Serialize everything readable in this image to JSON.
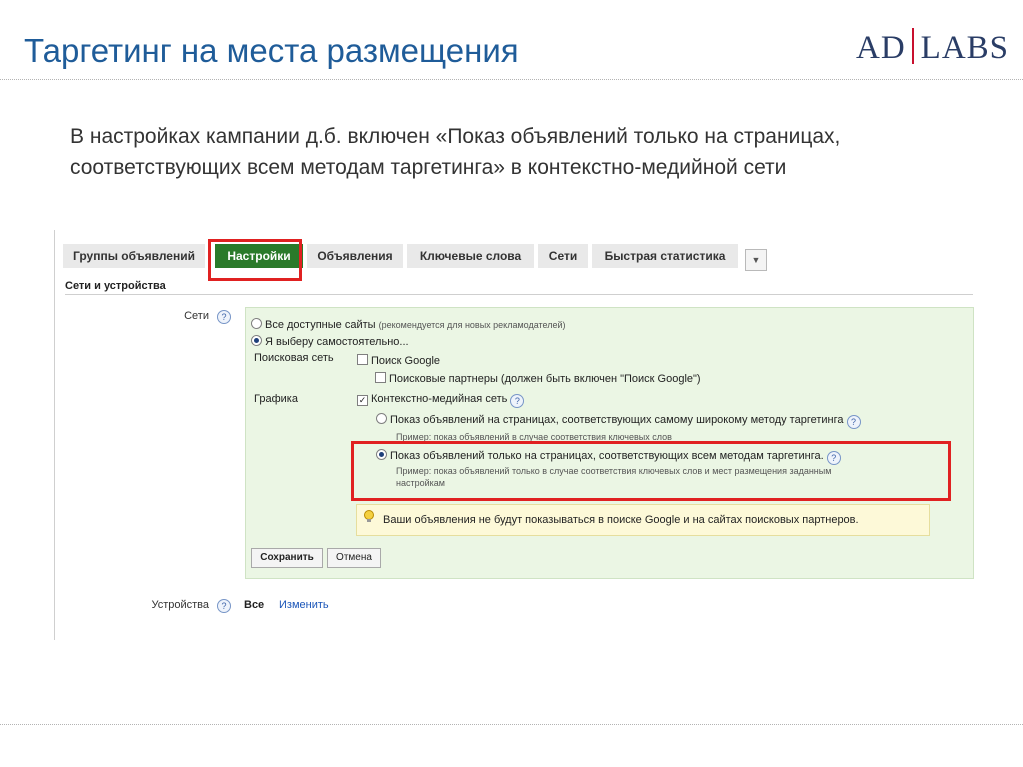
{
  "slide": {
    "title": "Таргетинг на места размещения",
    "logo": {
      "left": "AD",
      "right": "LABS"
    },
    "intro": "В настройках кампании д.б. включен «Показ объявлений только на страницах, соответствующих всем методам таргетинга»  в контекстно-медийной сети"
  },
  "tabs": [
    {
      "label": "Группы объявлений"
    },
    {
      "label": "Настройки",
      "active": true
    },
    {
      "label": "Объявления"
    },
    {
      "label": "Ключевые слова"
    },
    {
      "label": "Сети"
    },
    {
      "label": "Быстрая статистика"
    }
  ],
  "tab_dropdown_icon": "chevron-down-icon",
  "section_title": "Сети и устройства",
  "networks": {
    "label": "Сети",
    "help": "?",
    "option_all": "Все доступные сайты",
    "option_all_hint": "(рекомендуется для новых рекламодателей)",
    "option_manual": "Я выберу самостоятельно...",
    "search_label": "Поисковая сеть",
    "search_google": "Поиск Google",
    "search_partners": "Поисковые партнеры (должен быть включен \"Поиск Google\")",
    "display_label": "Графика",
    "display_network": "Контекстно-медийная сеть",
    "broad_option": "Показ объявлений на страницах, соответствующих самому широкому методу таргетинга",
    "broad_example": "Пример: показ объявлений в случае соответствия ключевых слов",
    "all_methods_option": "Показ объявлений только на страницах, соответствующих всем методам таргетинга.",
    "all_methods_example_1": "Пример: показ объявлений только в случае соответствия ключевых слов и мест размещения заданным",
    "all_methods_example_2": "настройкам",
    "warning": "Ваши объявления не будут показываться в поиске Google и на сайтах поисковых партнеров.",
    "save": "Сохранить",
    "cancel": "Отмена"
  },
  "devices": {
    "label": "Устройства",
    "value": "Все",
    "change": "Изменить"
  },
  "colors": {
    "title": "#1f5c99",
    "active_tab": "#2a7a2a",
    "highlight": "#e02121",
    "panel": "#ebf6e4",
    "link": "#1a55b8"
  }
}
